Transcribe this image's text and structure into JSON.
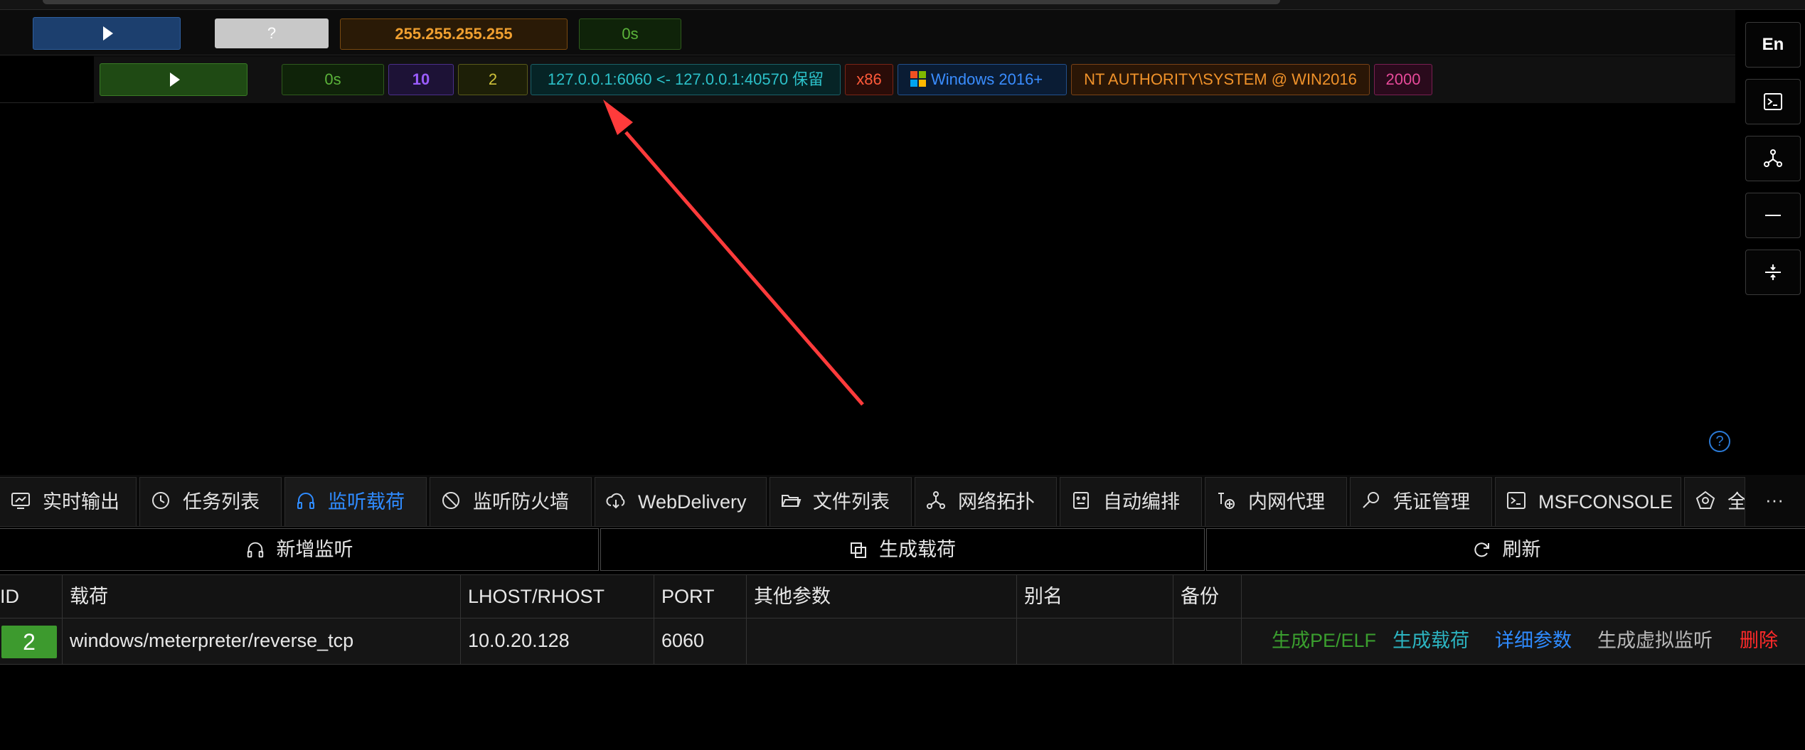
{
  "colors": {
    "blue_tag": "#3a7bd5",
    "green_tag": "#3d9a2e",
    "orange_text": "#f0a030",
    "purple_tag": "#9a5cff",
    "cyan_text": "#2cc1c9",
    "red_text": "#ff4b33",
    "pink_text": "#e84a9a",
    "active_tab": "#2f8bff",
    "arrow_red": "#ff3b3b"
  },
  "row1": {
    "play_icon": "play-icon",
    "unknown_label": "?",
    "ip": "255.255.255.255",
    "time": "0s"
  },
  "row2": {
    "play_icon": "play-icon",
    "time": "0s",
    "count_a": "10",
    "count_b": "2",
    "connection": "127.0.0.1:6060 <- 127.0.0.1:40570 保留",
    "arch": "x86",
    "os": "Windows 2016+",
    "user": "NT AUTHORITY\\SYSTEM @ WIN2016",
    "pid": "2000"
  },
  "side": {
    "lang": "En",
    "icons": [
      "terminal-icon",
      "topology-icon",
      "minimize-icon",
      "split-icon"
    ]
  },
  "help_label": "?",
  "tabs": [
    {
      "label": "实时输出",
      "icon": "monitor-icon"
    },
    {
      "label": "任务列表",
      "icon": "clock-icon"
    },
    {
      "label": "监听载荷",
      "icon": "headphones-icon",
      "active": true
    },
    {
      "label": "监听防火墙",
      "icon": "ban-icon"
    },
    {
      "label": "WebDelivery",
      "icon": "cloud-download-icon"
    },
    {
      "label": "文件列表",
      "icon": "folder-open-icon"
    },
    {
      "label": "网络拓扑",
      "icon": "topology-icon"
    },
    {
      "label": "自动编排",
      "icon": "robot-icon"
    },
    {
      "label": "内网代理",
      "icon": "proxy-icon"
    },
    {
      "label": "凭证管理",
      "icon": "key-search-icon"
    },
    {
      "label": "MSFCONSOLE",
      "icon": "terminal-icon"
    },
    {
      "label": "全",
      "icon": "pentagon-icon"
    }
  ],
  "tabs_more": "···",
  "actions": {
    "add_listener": "新增监听",
    "generate_payload": "生成载荷",
    "refresh": "刷新"
  },
  "table": {
    "headers": [
      "ID",
      "载荷",
      "LHOST/RHOST",
      "PORT",
      "其他参数",
      "别名",
      "备份",
      ""
    ],
    "rows": [
      {
        "id": "2",
        "payload": "windows/meterpreter/reverse_tcp",
        "lhost": "10.0.20.128",
        "port": "6060",
        "extra": "",
        "alias": "",
        "backup": "",
        "ops": [
          "生成PE/ELF",
          "生成载荷",
          "详细参数",
          "生成虚拟监听",
          "删除"
        ]
      }
    ]
  }
}
